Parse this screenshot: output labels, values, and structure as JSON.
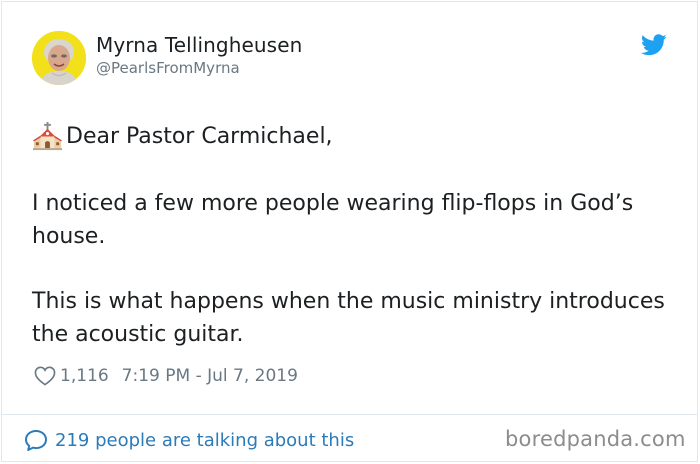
{
  "author": {
    "name": "Myrna Tellingheusen",
    "handle": "@PearlsFromMyrna"
  },
  "tweet": {
    "greeting": "Dear Pastor Carmichael,",
    "paragraph1": "I noticed a few more people wearing flip-flops in God’s house.",
    "paragraph2": "This is what happens when the music ministry introduces the acoustic guitar."
  },
  "meta": {
    "likes": "1,116",
    "timestamp": "7:19 PM - Jul 7, 2019"
  },
  "footer": {
    "talking_text": "219 people are talking about this"
  },
  "watermark": "boredpanda.com",
  "icons": {
    "platform": "twitter-bird-icon",
    "emoji": "church-icon",
    "like": "heart-icon",
    "reply": "speech-bubble-icon"
  },
  "colors": {
    "twitter_blue": "#1da1f2",
    "link_blue": "#2b7bb9",
    "text": "#1c2022",
    "muted": "#697882"
  }
}
